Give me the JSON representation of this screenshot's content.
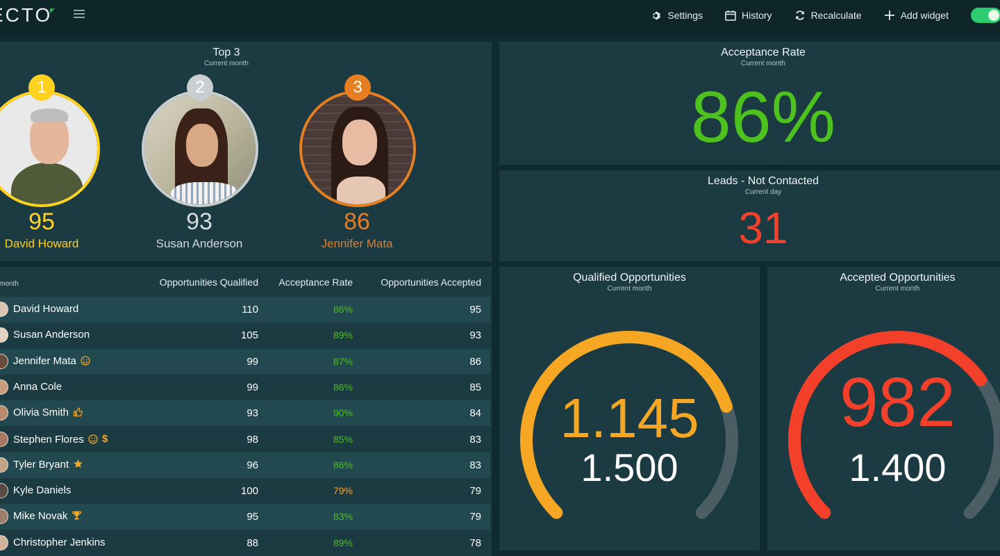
{
  "app": {
    "logo_text": "ECTO",
    "toolbar": {
      "settings": "Settings",
      "history": "History",
      "recalculate": "Recalculate",
      "add_widget": "Add widget"
    }
  },
  "top3": {
    "title": "Top 3",
    "subtitle": "Current month",
    "people": [
      {
        "rank": "1",
        "score": "95",
        "name": "David Howard",
        "color": "#ffd21f"
      },
      {
        "rank": "2",
        "score": "93",
        "name": "Susan Anderson",
        "color": "#c9cfd1"
      },
      {
        "rank": "3",
        "score": "86",
        "name": "Jennifer Mata",
        "color": "#e67e22"
      }
    ]
  },
  "acceptance": {
    "title": "Acceptance Rate",
    "subtitle": "Current month",
    "value": "86%",
    "color": "#4dc11d"
  },
  "leads": {
    "title": "Leads - Not Contacted",
    "subtitle": "Current day",
    "value": "31",
    "color": "#f2402a"
  },
  "table": {
    "period_label": "month",
    "columns": [
      "Opportunities Qualified",
      "Acceptance Rate",
      "Opportunities Accepted"
    ],
    "rows": [
      {
        "name": "David Howard",
        "icons": [],
        "qualified": "110",
        "rate": "86%",
        "rate_color": "#4dc11d",
        "accepted": "95"
      },
      {
        "name": "Susan Anderson",
        "icons": [],
        "qualified": "105",
        "rate": "89%",
        "rate_color": "#4dc11d",
        "accepted": "93"
      },
      {
        "name": "Jennifer Mata",
        "icons": [
          "smile-icon"
        ],
        "qualified": "99",
        "rate": "87%",
        "rate_color": "#4dc11d",
        "accepted": "86"
      },
      {
        "name": "Anna Cole",
        "icons": [],
        "qualified": "99",
        "rate": "86%",
        "rate_color": "#4dc11d",
        "accepted": "85"
      },
      {
        "name": "Olivia Smith",
        "icons": [
          "thumbs-up-icon"
        ],
        "qualified": "93",
        "rate": "90%",
        "rate_color": "#4dc11d",
        "accepted": "84"
      },
      {
        "name": "Stephen Flores",
        "icons": [
          "smile-icon",
          "dollar-icon"
        ],
        "qualified": "98",
        "rate": "85%",
        "rate_color": "#4dc11d",
        "accepted": "83"
      },
      {
        "name": "Tyler Bryant",
        "icons": [
          "star-icon"
        ],
        "qualified": "96",
        "rate": "86%",
        "rate_color": "#4dc11d",
        "accepted": "83"
      },
      {
        "name": "Kyle Daniels",
        "icons": [],
        "qualified": "100",
        "rate": "79%",
        "rate_color": "#f5a623",
        "accepted": "79"
      },
      {
        "name": "Mike Novak",
        "icons": [
          "trophy-icon"
        ],
        "qualified": "95",
        "rate": "83%",
        "rate_color": "#4dc11d",
        "accepted": "79"
      },
      {
        "name": "Christopher Jenkins",
        "icons": [],
        "qualified": "88",
        "rate": "89%",
        "rate_color": "#4dc11d",
        "accepted": "78"
      }
    ]
  },
  "qualified_gauge": {
    "title": "Qualified Opportunities",
    "subtitle": "Current month",
    "value": "1.145",
    "target": "1.500",
    "fraction": 0.763,
    "color": "#f5a623",
    "track_color": "#4a5e63"
  },
  "accepted_gauge": {
    "title": "Accepted Opportunities",
    "subtitle": "Current month",
    "value": "982",
    "target": "1.400",
    "fraction": 0.701,
    "color": "#f2402a",
    "track_color": "#4a5e63"
  }
}
